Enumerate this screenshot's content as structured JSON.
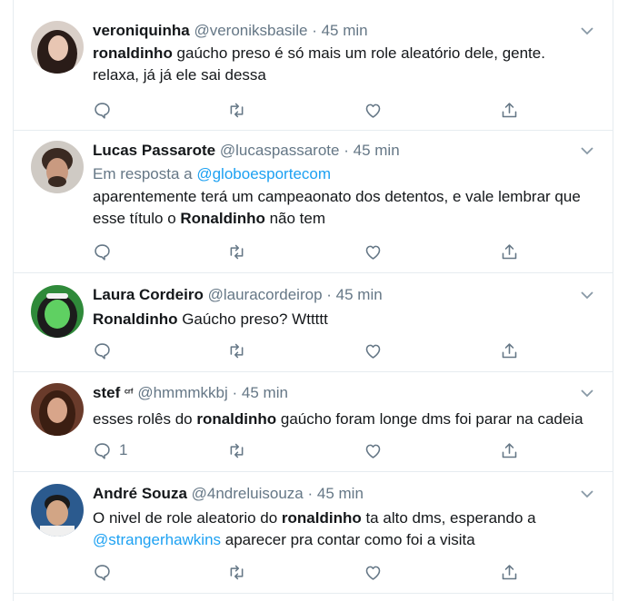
{
  "tweets": [
    {
      "name": "veroniquinha",
      "handle": "@veroniksbasile",
      "time": "45 min",
      "segments": [
        {
          "t": "ronaldinho",
          "s": "bold"
        },
        {
          "t": " gaúcho preso é só mais um role aleatório dele, gente. relaxa, já já ele sai dessa",
          "s": "plain"
        }
      ],
      "reply_count": "",
      "colors": {
        "avatar_bg": "#d9cfc8",
        "hair": "#2a1c18",
        "face": "#e8c6b3"
      }
    },
    {
      "name": "Lucas Passarote",
      "handle": "@lucaspassarote",
      "time": "45 min",
      "reply_prefix": "Em resposta a",
      "reply_handle": "@globoesportecom",
      "segments": [
        {
          "t": "aparentemente terá um campeaonato dos detentos, e vale lembrar que esse título o ",
          "s": "plain"
        },
        {
          "t": "Ronaldinho",
          "s": "bold"
        },
        {
          "t": " não tem",
          "s": "plain"
        }
      ],
      "reply_count": "",
      "colors": {
        "avatar_bg": "#cfcac4",
        "hair": "#3a2a22",
        "face": "#c99a80"
      }
    },
    {
      "name": "Laura Cordeiro",
      "handle": "@lauracordeirop",
      "time": "45 min",
      "segments": [
        {
          "t": "Ronaldinho",
          "s": "bold"
        },
        {
          "t": " Gaúcho preso? Wttttt",
          "s": "plain"
        }
      ],
      "reply_count": "",
      "colors": {
        "avatar_bg": "#2f8a3a",
        "hair": "#1c1c1c",
        "face": "#5fd062"
      }
    },
    {
      "name": "stef",
      "name_suffix": "ᶜʳᶠ",
      "handle": "@hmmmkkbj",
      "time": "45 min",
      "segments": [
        {
          "t": "esses rolês do ",
          "s": "plain"
        },
        {
          "t": "ronaldinho",
          "s": "bold"
        },
        {
          "t": " gaúcho foram longe dms foi parar na cadeia",
          "s": "plain"
        }
      ],
      "reply_count": "1",
      "colors": {
        "avatar_bg": "#6a3b2b",
        "hair": "#3b1e12",
        "face": "#d8a58a"
      }
    },
    {
      "name": "André Souza",
      "handle": "@4ndreluisouza",
      "time": "45 min",
      "segments": [
        {
          "t": "O nivel de role aleatorio do ",
          "s": "plain"
        },
        {
          "t": "ronaldinho",
          "s": "bold"
        },
        {
          "t": " ta alto dms, esperando a ",
          "s": "plain"
        },
        {
          "t": "@strangerhawkins",
          "s": "link"
        },
        {
          "t": " aparecer pra contar como foi a visita",
          "s": "plain"
        }
      ],
      "reply_count": "",
      "colors": {
        "avatar_bg": "#2b5a8e",
        "hair": "#1a1a1a",
        "face": "#d2a585"
      }
    }
  ],
  "icons": {
    "reply": "reply-icon",
    "retweet": "retweet-icon",
    "like": "like-icon",
    "share": "share-icon",
    "more": "chevron-down-icon"
  },
  "theme": {
    "link": "#1da1f2",
    "secondary": "#657786",
    "border": "#e6ecf0"
  }
}
